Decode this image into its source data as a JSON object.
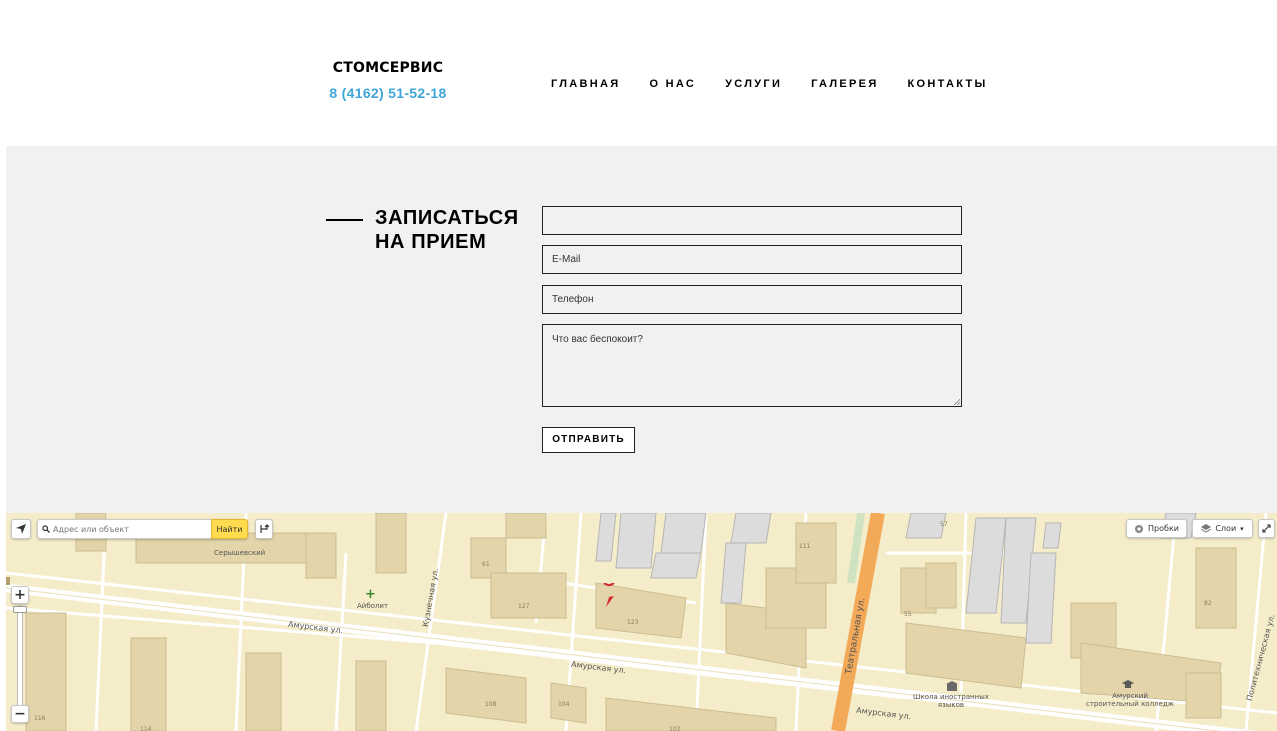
{
  "brand": {
    "name": "СТОМСЕРВИС",
    "phone": "8 (4162) 51-52-18"
  },
  "nav": [
    "ГЛАВНАЯ",
    "О НАС",
    "УСЛУГИ",
    "ГАЛЕРЕЯ",
    "КОНТАКТЫ"
  ],
  "form": {
    "title": "ЗАПИСАТЬСЯ\nНА ПРИЕМ",
    "name_value": "",
    "email_placeholder": "E-Mail",
    "phone_placeholder": "Телефон",
    "message_placeholder": "Что вас беспокоит?",
    "submit_label": "ОТПРАВИТЬ"
  },
  "map": {
    "search_placeholder": "Адрес или объект",
    "search_button": "Найти",
    "traffic_label": "Пробки",
    "layers_label": "Слои",
    "streets": {
      "amurskaya_1": "Амурская ул.",
      "amurskaya_2": "Амурская ул.",
      "amurskaya_3": "Амурская ул.",
      "kuznechnaya": "Кузнечная ул.",
      "teatralnaya": "Театральная ул.",
      "politekhnicheskaya": "Политехническая ул."
    },
    "pois": {
      "seryshevsky": "Серышевский",
      "aibolit": "Айболит",
      "school": "Школа иностранных\nязыков",
      "college": "Амурский\nстроительный колледж"
    },
    "house_numbers": [
      "61",
      "127",
      "123",
      "111",
      "57",
      "55",
      "82",
      "108",
      "104",
      "102",
      "116",
      "114"
    ],
    "colors": {
      "land": "#f5ecc9",
      "building": "#e6d9b2",
      "building_side": "#cbbd92",
      "road": "#ffffff",
      "main_road": "#f6b86a",
      "accent": "#3ea6d8"
    }
  }
}
